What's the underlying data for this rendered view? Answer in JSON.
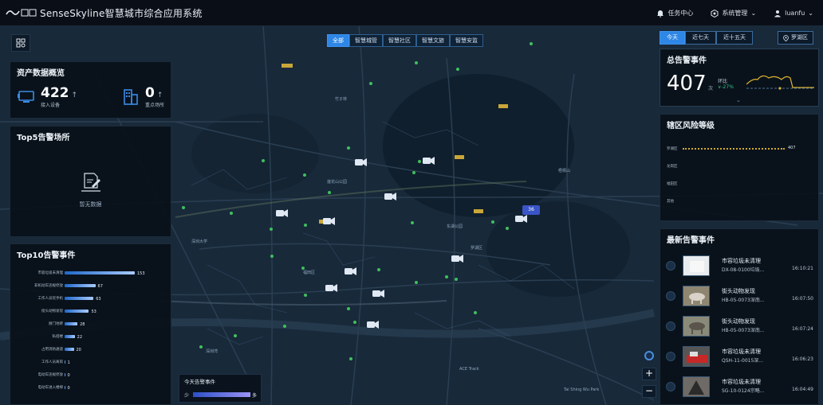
{
  "header": {
    "brand": "SenseSkyline智慧城市综合应用系统",
    "task_center": "任务中心",
    "system_mgmt": "系统管理",
    "user": "luanfu"
  },
  "tabs": [
    {
      "label": "全部",
      "active": true
    },
    {
      "label": "智慧城管"
    },
    {
      "label": "智慧社区"
    },
    {
      "label": "智慧文旅"
    },
    {
      "label": "智慧安监"
    }
  ],
  "asset_overview": {
    "title": "资产数据概览",
    "devices_value": "422",
    "devices_label": "接入设备",
    "places_value": "0",
    "places_label": "重点场所"
  },
  "top5": {
    "title": "Top5告警场所",
    "empty_text": "暂无数据"
  },
  "top10": {
    "title": "Top10告警事件",
    "items": [
      {
        "label": "市容垃圾未清理",
        "value": 153
      },
      {
        "label": "非机动车违规停放",
        "value": 67
      },
      {
        "label": "工作人员玩手机",
        "value": 63
      },
      {
        "label": "街头动物发现",
        "value": 53
      },
      {
        "label": "厨门地砖",
        "value": 28
      },
      {
        "label": "私搭楼",
        "value": 22
      },
      {
        "label": "占用消防通道",
        "value": 20
      },
      {
        "label": "工作人员离岗",
        "value": 1
      },
      {
        "label": "电动车违规停放",
        "value": 0
      },
      {
        "label": "电动车进入楼梯",
        "value": 0
      }
    ]
  },
  "range_tabs": [
    {
      "label": "今天",
      "active": true
    },
    {
      "label": "近七天"
    },
    {
      "label": "近十五天"
    }
  ],
  "area_button": "罗湖区",
  "total_alerts": {
    "title": "总告警事件",
    "value": "407",
    "unit": "次",
    "ratio_label": "环比",
    "ratio_value": "∨-27%"
  },
  "risk": {
    "title": "辖区风险等级",
    "items": [
      {
        "label": "罗湖区",
        "value": 407
      },
      {
        "label": "龙岗区",
        "value": null
      },
      {
        "label": "福田区",
        "value": null
      },
      {
        "label": "其他",
        "value": null
      }
    ]
  },
  "latest_alerts": {
    "title": "最新告警事件",
    "items": [
      {
        "type": "市容垃圾未清理",
        "camera": "DX-08-0100垃圾...",
        "time": "16:10:21"
      },
      {
        "type": "街头动物发现",
        "camera": "HB-05-0073深南...",
        "time": "16:07:50"
      },
      {
        "type": "街头动物发现",
        "camera": "HB-05-0073深南...",
        "time": "16:07:24"
      },
      {
        "type": "市容垃圾未清理",
        "camera": "QSH-11-0015深...",
        "time": "16:06:23"
      },
      {
        "type": "市容垃圾未清理",
        "camera": "SG-10-0124宗略...",
        "time": "16:04:49"
      }
    ]
  },
  "legend": {
    "title": "今天告警事件",
    "low": "少",
    "high": "多"
  },
  "cluster_count": "36",
  "map_labels": {
    "l1": "深圳大学",
    "l2": "竹子林",
    "l3": "罗湖区",
    "l4": "东湖公园",
    "l5": "福田区",
    "l6": "深圳湾",
    "l7": "ACE Track",
    "l8": "Tai Shing Wu Park",
    "l9": "莲花山公园",
    "l10": "梧桐山"
  }
}
